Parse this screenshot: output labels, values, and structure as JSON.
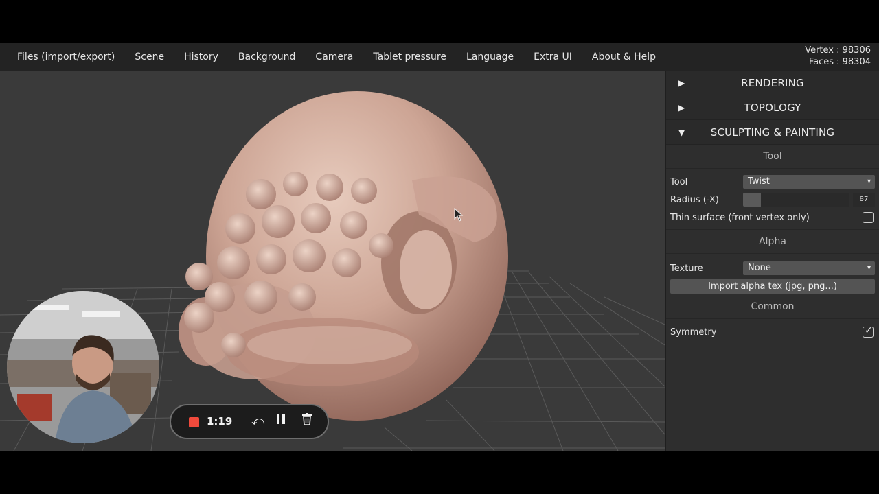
{
  "menu": {
    "items": [
      {
        "label": "Files (import/export)"
      },
      {
        "label": "Scene"
      },
      {
        "label": "History"
      },
      {
        "label": "Background"
      },
      {
        "label": "Camera"
      },
      {
        "label": "Tablet pressure"
      },
      {
        "label": "Language"
      },
      {
        "label": "Extra UI"
      },
      {
        "label": "About & Help"
      }
    ]
  },
  "stats": {
    "vertex": "Vertex : 98306",
    "faces": "Faces : 98304"
  },
  "panel": {
    "folders": [
      {
        "label": "RENDERING",
        "arrow": "▶"
      },
      {
        "label": "TOPOLOGY",
        "arrow": "▶"
      },
      {
        "label": "SCULPTING & PAINTING",
        "arrow": "▼"
      }
    ],
    "tool_section": "Tool",
    "tool_label": "Tool",
    "tool_value": "Twist",
    "radius_label": "Radius (-X)",
    "radius_value": "87",
    "radius_fraction": 0.17,
    "thin_surface_label": "Thin surface (front vertex only)",
    "thin_surface_checked": false,
    "alpha_section": "Alpha",
    "texture_label": "Texture",
    "texture_value": "None",
    "import_alpha_label": "Import alpha tex (jpg, png...)",
    "common_section": "Common",
    "symmetry_label": "Symmetry",
    "symmetry_checked": true
  },
  "recorder": {
    "time": "1:19"
  },
  "colors": {
    "menubar": "#232323",
    "viewport": "#3a3a3a",
    "panel": "#2e2e2e",
    "record": "#f04a3c",
    "mesh": "#c9a295"
  }
}
